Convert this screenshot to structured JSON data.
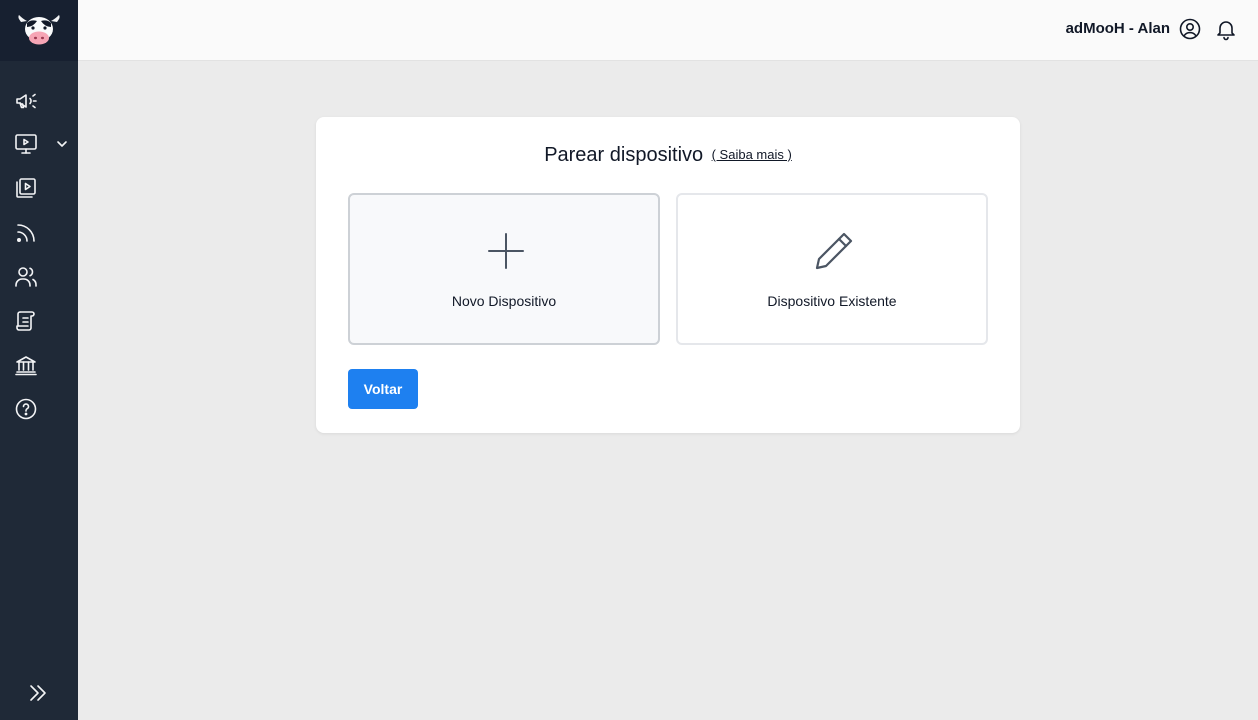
{
  "header": {
    "user_label": "adMooH - Alan"
  },
  "sidebar": {
    "items": [
      {
        "name": "campaigns",
        "icon": "megaphone-icon"
      },
      {
        "name": "screens",
        "icon": "monitor-play-icon",
        "has_submenu": true
      },
      {
        "name": "media",
        "icon": "video-library-icon"
      },
      {
        "name": "feeds",
        "icon": "rss-icon"
      },
      {
        "name": "users",
        "icon": "users-icon"
      },
      {
        "name": "reports",
        "icon": "scroll-icon"
      },
      {
        "name": "financial",
        "icon": "bank-icon"
      },
      {
        "name": "help",
        "icon": "help-circle-icon"
      }
    ]
  },
  "main": {
    "title": "Parear dispositivo",
    "learn_more": "( Saiba mais )",
    "options": {
      "new_label": "Novo Dispositivo",
      "existing_label": "Dispositivo Existente"
    },
    "back_button": "Voltar"
  },
  "colors": {
    "sidebar_bg": "#1f2937",
    "accent": "#1e80f0",
    "page_bg": "#ebebeb"
  }
}
